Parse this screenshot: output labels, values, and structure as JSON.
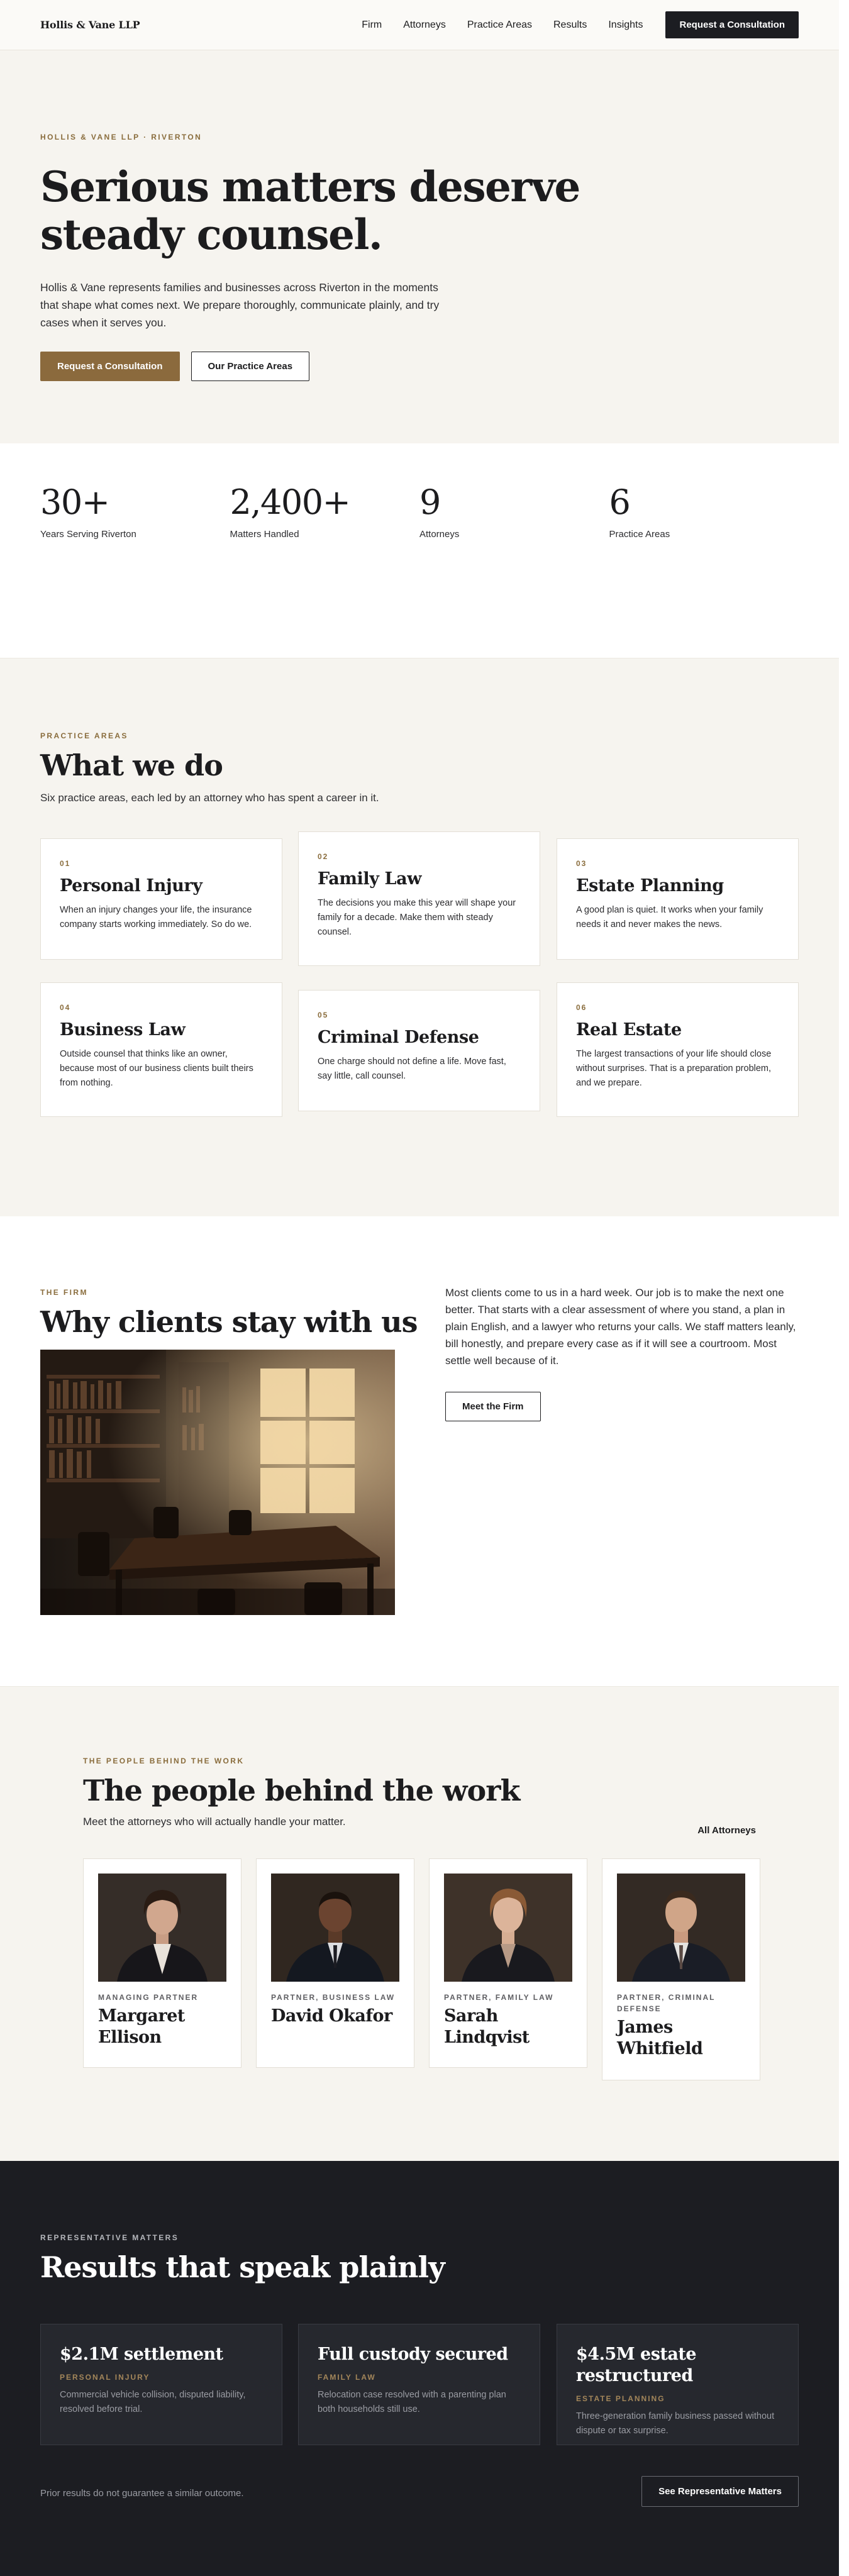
{
  "nav": {
    "logo": "Hollis & Vane LLP",
    "links": [
      "Firm",
      "Attorneys",
      "Practice Areas",
      "Results",
      "Insights"
    ],
    "cta": "Request a Consultation"
  },
  "hero": {
    "eyebrow": "HOLLIS & VANE LLP · RIVERTON",
    "title": "Serious matters deserve steady counsel.",
    "body": "Hollis & Vane represents families and businesses across Riverton in the moments that shape what comes next. We prepare thoroughly, communicate plainly, and try cases when it serves you.",
    "primary_button": "Request a Consultation",
    "secondary_button": "Our Practice Areas"
  },
  "stats": [
    {
      "value": "30+",
      "label": "Years Serving Riverton"
    },
    {
      "value": "2,400+",
      "label": "Matters Handled"
    },
    {
      "value": "9",
      "label": "Attorneys"
    },
    {
      "value": "6",
      "label": "Practice Areas"
    }
  ],
  "practice": {
    "eyebrow": "PRACTICE AREAS",
    "title": "What we do",
    "subtitle": "Six practice areas, each led by an attorney who has spent a career in it.",
    "cards": [
      {
        "num": "01",
        "title": "Personal Injury",
        "body": "When an injury changes your life, the insurance company starts working immediately. So do we."
      },
      {
        "num": "02",
        "title": "Family Law",
        "body": "The decisions you make this year will shape your family for a decade. Make them with steady counsel."
      },
      {
        "num": "03",
        "title": "Estate Planning",
        "body": "A good plan is quiet. It works when your family needs it and never makes the news."
      },
      {
        "num": "04",
        "title": "Business Law",
        "body": "Outside counsel that thinks like an owner, because most of our business clients built theirs from nothing."
      },
      {
        "num": "05",
        "title": "Criminal Defense",
        "body": "One charge should not define a life. Move fast, say little, call counsel."
      },
      {
        "num": "06",
        "title": "Real Estate",
        "body": "The largest transactions of your life should close without surprises. That is a preparation problem, and we prepare."
      }
    ]
  },
  "firm": {
    "eyebrow": "THE FIRM",
    "title": "Why clients stay with us",
    "body": "Most clients come to us in a hard week. Our job is to make the next one better. That starts with a clear assessment of where you stand, a plan in plain English, and a lawyer who returns your calls. We staff matters leanly, bill honestly, and prepare every case as if it will see a courtroom. Most settle well because of it.",
    "button": "Meet the Firm"
  },
  "team": {
    "eyebrow": "THE PEOPLE BEHIND THE WORK",
    "title": "The people behind the work",
    "subtitle": "Meet the attorneys who will actually handle your matter.",
    "link": "All Attorneys",
    "people": [
      {
        "role": "MANAGING PARTNER",
        "name": "Margaret Ellison"
      },
      {
        "role": "PARTNER, BUSINESS LAW",
        "name": "David Okafor"
      },
      {
        "role": "PARTNER, FAMILY LAW",
        "name": "Sarah Lindqvist"
      },
      {
        "role": "PARTNER, CRIMINAL DEFENSE",
        "name": "James Whitfield"
      }
    ]
  },
  "results": {
    "eyebrow": "REPRESENTATIVE MATTERS",
    "title": "Results that speak plainly",
    "cards": [
      {
        "title": "$2.1M settlement",
        "tag": "PERSONAL INJURY",
        "body": "Commercial vehicle collision, disputed liability, resolved before trial."
      },
      {
        "title": "Full custody secured",
        "tag": "FAMILY LAW",
        "body": "Relocation case resolved with a parenting plan both households still use."
      },
      {
        "title": "$4.5M estate restructured",
        "tag": "ESTATE PLANNING",
        "body": "Three-generation family business passed without dispute or tax surprise."
      }
    ],
    "disclaimer": "Prior results do not guarantee a similar outcome.",
    "button": "See Representative Matters"
  },
  "colors": {
    "accent": "#8b6a3d",
    "dark": "#1c1d22",
    "cream": "#f6f4ef"
  }
}
